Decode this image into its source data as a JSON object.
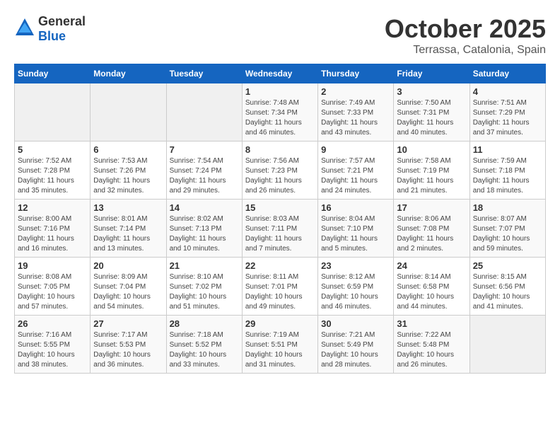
{
  "logo": {
    "text_general": "General",
    "text_blue": "Blue"
  },
  "header": {
    "month": "October 2025",
    "location": "Terrassa, Catalonia, Spain"
  },
  "weekdays": [
    "Sunday",
    "Monday",
    "Tuesday",
    "Wednesday",
    "Thursday",
    "Friday",
    "Saturday"
  ],
  "weeks": [
    [
      {
        "day": "",
        "content": ""
      },
      {
        "day": "",
        "content": ""
      },
      {
        "day": "",
        "content": ""
      },
      {
        "day": "1",
        "content": "Sunrise: 7:48 AM\nSunset: 7:34 PM\nDaylight: 11 hours\nand 46 minutes."
      },
      {
        "day": "2",
        "content": "Sunrise: 7:49 AM\nSunset: 7:33 PM\nDaylight: 11 hours\nand 43 minutes."
      },
      {
        "day": "3",
        "content": "Sunrise: 7:50 AM\nSunset: 7:31 PM\nDaylight: 11 hours\nand 40 minutes."
      },
      {
        "day": "4",
        "content": "Sunrise: 7:51 AM\nSunset: 7:29 PM\nDaylight: 11 hours\nand 37 minutes."
      }
    ],
    [
      {
        "day": "5",
        "content": "Sunrise: 7:52 AM\nSunset: 7:28 PM\nDaylight: 11 hours\nand 35 minutes."
      },
      {
        "day": "6",
        "content": "Sunrise: 7:53 AM\nSunset: 7:26 PM\nDaylight: 11 hours\nand 32 minutes."
      },
      {
        "day": "7",
        "content": "Sunrise: 7:54 AM\nSunset: 7:24 PM\nDaylight: 11 hours\nand 29 minutes."
      },
      {
        "day": "8",
        "content": "Sunrise: 7:56 AM\nSunset: 7:23 PM\nDaylight: 11 hours\nand 26 minutes."
      },
      {
        "day": "9",
        "content": "Sunrise: 7:57 AM\nSunset: 7:21 PM\nDaylight: 11 hours\nand 24 minutes."
      },
      {
        "day": "10",
        "content": "Sunrise: 7:58 AM\nSunset: 7:19 PM\nDaylight: 11 hours\nand 21 minutes."
      },
      {
        "day": "11",
        "content": "Sunrise: 7:59 AM\nSunset: 7:18 PM\nDaylight: 11 hours\nand 18 minutes."
      }
    ],
    [
      {
        "day": "12",
        "content": "Sunrise: 8:00 AM\nSunset: 7:16 PM\nDaylight: 11 hours\nand 16 minutes."
      },
      {
        "day": "13",
        "content": "Sunrise: 8:01 AM\nSunset: 7:14 PM\nDaylight: 11 hours\nand 13 minutes."
      },
      {
        "day": "14",
        "content": "Sunrise: 8:02 AM\nSunset: 7:13 PM\nDaylight: 11 hours\nand 10 minutes."
      },
      {
        "day": "15",
        "content": "Sunrise: 8:03 AM\nSunset: 7:11 PM\nDaylight: 11 hours\nand 7 minutes."
      },
      {
        "day": "16",
        "content": "Sunrise: 8:04 AM\nSunset: 7:10 PM\nDaylight: 11 hours\nand 5 minutes."
      },
      {
        "day": "17",
        "content": "Sunrise: 8:06 AM\nSunset: 7:08 PM\nDaylight: 11 hours\nand 2 minutes."
      },
      {
        "day": "18",
        "content": "Sunrise: 8:07 AM\nSunset: 7:07 PM\nDaylight: 10 hours\nand 59 minutes."
      }
    ],
    [
      {
        "day": "19",
        "content": "Sunrise: 8:08 AM\nSunset: 7:05 PM\nDaylight: 10 hours\nand 57 minutes."
      },
      {
        "day": "20",
        "content": "Sunrise: 8:09 AM\nSunset: 7:04 PM\nDaylight: 10 hours\nand 54 minutes."
      },
      {
        "day": "21",
        "content": "Sunrise: 8:10 AM\nSunset: 7:02 PM\nDaylight: 10 hours\nand 51 minutes."
      },
      {
        "day": "22",
        "content": "Sunrise: 8:11 AM\nSunset: 7:01 PM\nDaylight: 10 hours\nand 49 minutes."
      },
      {
        "day": "23",
        "content": "Sunrise: 8:12 AM\nSunset: 6:59 PM\nDaylight: 10 hours\nand 46 minutes."
      },
      {
        "day": "24",
        "content": "Sunrise: 8:14 AM\nSunset: 6:58 PM\nDaylight: 10 hours\nand 44 minutes."
      },
      {
        "day": "25",
        "content": "Sunrise: 8:15 AM\nSunset: 6:56 PM\nDaylight: 10 hours\nand 41 minutes."
      }
    ],
    [
      {
        "day": "26",
        "content": "Sunrise: 7:16 AM\nSunset: 5:55 PM\nDaylight: 10 hours\nand 38 minutes."
      },
      {
        "day": "27",
        "content": "Sunrise: 7:17 AM\nSunset: 5:53 PM\nDaylight: 10 hours\nand 36 minutes."
      },
      {
        "day": "28",
        "content": "Sunrise: 7:18 AM\nSunset: 5:52 PM\nDaylight: 10 hours\nand 33 minutes."
      },
      {
        "day": "29",
        "content": "Sunrise: 7:19 AM\nSunset: 5:51 PM\nDaylight: 10 hours\nand 31 minutes."
      },
      {
        "day": "30",
        "content": "Sunrise: 7:21 AM\nSunset: 5:49 PM\nDaylight: 10 hours\nand 28 minutes."
      },
      {
        "day": "31",
        "content": "Sunrise: 7:22 AM\nSunset: 5:48 PM\nDaylight: 10 hours\nand 26 minutes."
      },
      {
        "day": "",
        "content": ""
      }
    ]
  ]
}
